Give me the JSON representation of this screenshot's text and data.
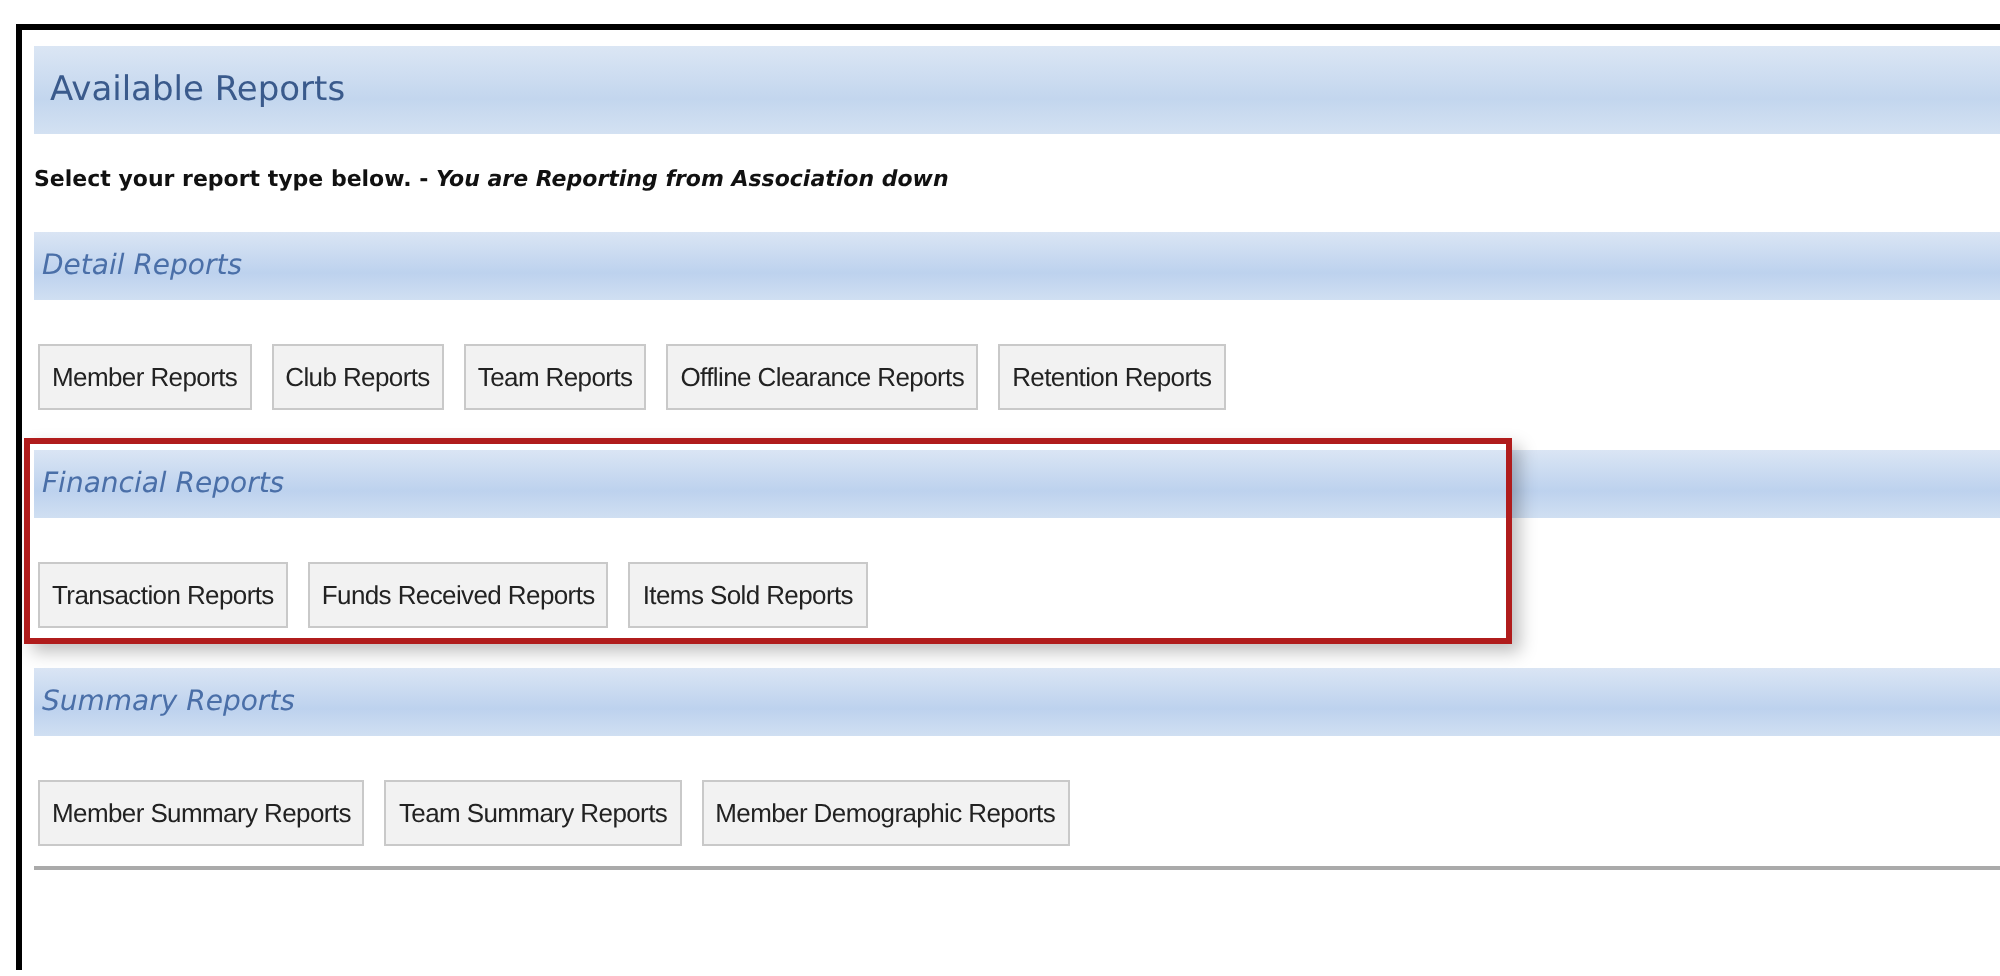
{
  "title": "Available Reports",
  "instruction": "Select your report type below. - *You are Reporting from Association down*",
  "sections": [
    {
      "title": "Detail Reports",
      "highlighted": false,
      "buttons": [
        "Member Reports",
        "Club Reports",
        "Team Reports",
        "Offline Clearance Reports",
        "Retention Reports"
      ]
    },
    {
      "title": "Financial Reports",
      "highlighted": true,
      "buttons": [
        "Transaction Reports",
        "Funds Received Reports",
        "Items Sold Reports"
      ]
    },
    {
      "title": "Summary Reports",
      "highlighted": false,
      "buttons": [
        "Member Summary Reports",
        "Team Summary Reports",
        "Member Demographic Reports"
      ]
    }
  ]
}
